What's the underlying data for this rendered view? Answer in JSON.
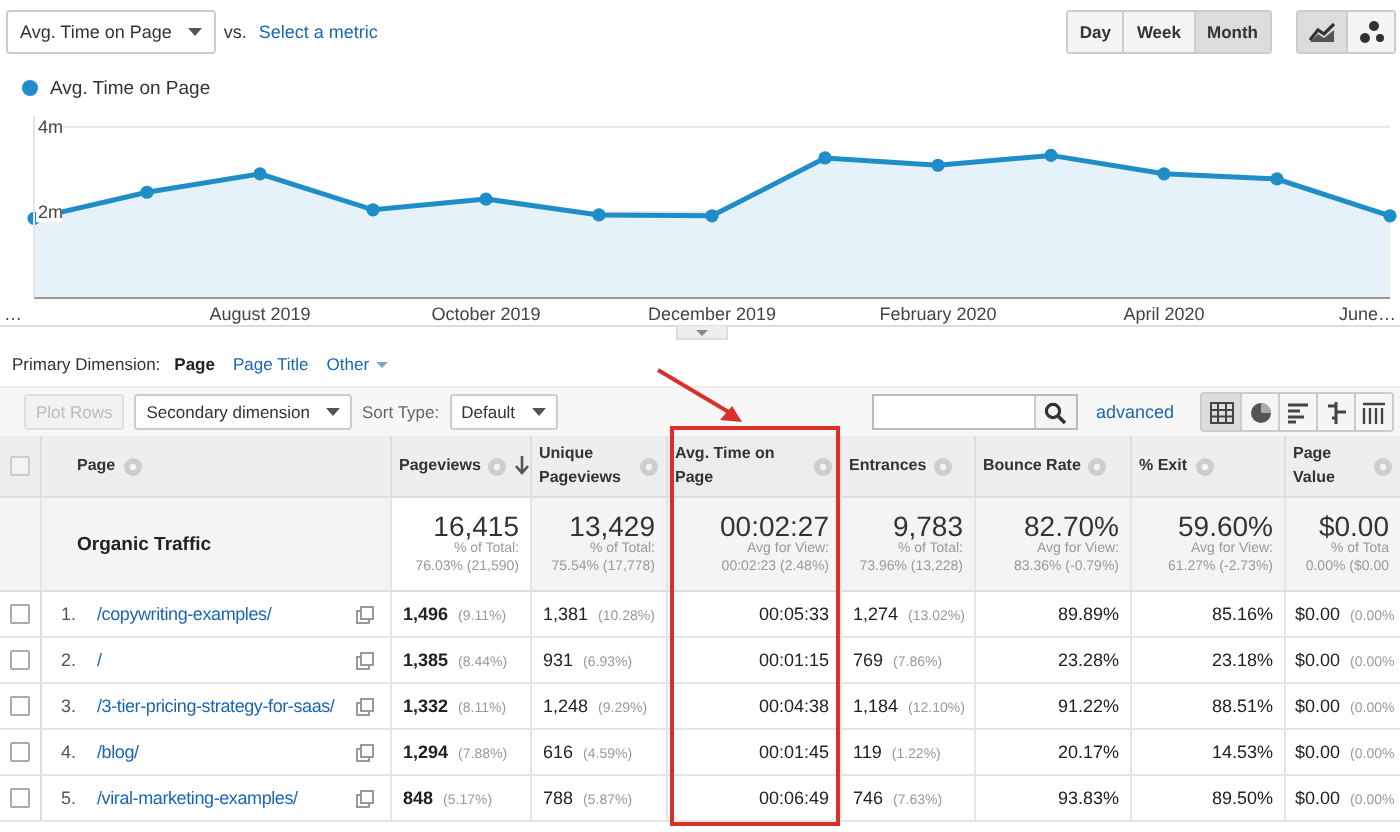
{
  "metric_selector": {
    "value": "Avg. Time on Page"
  },
  "vs_label": "vs.",
  "select_metric_link": "Select a metric",
  "period_buttons": [
    {
      "label": "Day",
      "selected": false
    },
    {
      "label": "Week",
      "selected": false
    },
    {
      "label": "Month",
      "selected": true
    }
  ],
  "chart_type_buttons": [
    {
      "kind": "line",
      "selected": true
    },
    {
      "kind": "motion",
      "selected": false
    }
  ],
  "chart": {
    "chart_data": {
      "type": "area",
      "categories": [
        "…",
        null,
        "August 2019",
        null,
        "October 2019",
        null,
        "December 2019",
        null,
        "February 2020",
        null,
        "April 2020",
        null,
        "June…"
      ],
      "ylim": [
        0,
        4.25
      ],
      "yticks": [
        {
          "value": 2,
          "label": "2m"
        },
        {
          "value": 4,
          "label": "4m"
        }
      ],
      "series": [
        {
          "name": "Avg. Time on Page",
          "color": "#1f8dc8",
          "values": [
            1.86,
            2.47,
            2.9,
            2.06,
            2.31,
            1.94,
            1.92,
            3.27,
            3.1,
            3.33,
            2.9,
            2.78,
            1.92
          ]
        }
      ]
    }
  },
  "primary_dimension": {
    "label": "Primary Dimension:",
    "options": [
      {
        "label": "Page",
        "selected": true
      },
      {
        "label": "Page Title",
        "selected": false
      },
      {
        "label": "Other",
        "selected": false
      }
    ]
  },
  "toolbar": {
    "plot_rows": {
      "label": "Plot Rows",
      "disabled": true
    },
    "secondary_dimension": "Secondary dimension",
    "sort_type_label": "Sort Type:",
    "sort_type": "Default",
    "advanced_link": "advanced",
    "view_buttons": [
      {
        "kind": "table",
        "selected": true
      },
      {
        "kind": "pie",
        "selected": false
      },
      {
        "kind": "performance",
        "selected": false
      },
      {
        "kind": "comparison",
        "selected": false
      },
      {
        "kind": "pivot",
        "selected": false
      }
    ]
  },
  "table": {
    "select_all": {
      "checked": false
    },
    "columns": [
      {
        "label": "Page",
        "sorted": false,
        "highlighted": false
      },
      {
        "label": "Pageviews",
        "sorted": true,
        "highlighted": false
      },
      {
        "label": "Unique Pageviews",
        "sorted": false,
        "highlighted": false
      },
      {
        "label": "Avg. Time on Page",
        "sorted": false,
        "highlighted": true
      },
      {
        "label": "Entrances",
        "sorted": false,
        "highlighted": false
      },
      {
        "label": "Bounce Rate",
        "sorted": false,
        "highlighted": false
      },
      {
        "label": "% Exit",
        "sorted": false,
        "highlighted": false
      },
      {
        "label": "Page Value",
        "sorted": false,
        "highlighted": false
      }
    ],
    "totals": {
      "cells": [
        {
          "value": "Organic Traffic"
        },
        {
          "value": "16,415",
          "note": "% of Total:",
          "detail": "76.03% (21,590)"
        },
        {
          "value": "13,429",
          "note": "% of Total:",
          "detail": "75.54% (17,778)"
        },
        {
          "value": "00:02:27",
          "note": "Avg for View:",
          "detail": "00:02:23 (2.48%)"
        },
        {
          "value": "9,783",
          "note": "% of Total:",
          "detail": "73.96% (13,228)"
        },
        {
          "value": "82.70%",
          "note": "Avg for View:",
          "detail": "83.36% (-0.79%)"
        },
        {
          "value": "59.60%",
          "note": "Avg for View:",
          "detail": "61.27% (-2.73%)"
        },
        {
          "value": "$0.00",
          "note": "% of Tota",
          "detail": "0.00% ($0.00"
        }
      ]
    },
    "rows": [
      {
        "checked": false,
        "cells": [
          {
            "index": "1.",
            "value": "/copywriting-examples/"
          },
          {
            "value": "1,496",
            "pct": "(9.11%)"
          },
          {
            "value": "1,381",
            "pct": "(10.28%)"
          },
          {
            "value": "00:05:33"
          },
          {
            "value": "1,274",
            "pct": "(13.02%)"
          },
          {
            "value": "89.89%"
          },
          {
            "value": "85.16%"
          },
          {
            "value": "$0.00",
            "pct": "(0.00%"
          }
        ]
      },
      {
        "checked": false,
        "cells": [
          {
            "index": "2.",
            "value": "/"
          },
          {
            "value": "1,385",
            "pct": "(8.44%)"
          },
          {
            "value": "931",
            "pct": "(6.93%)"
          },
          {
            "value": "00:01:15"
          },
          {
            "value": "769",
            "pct": "(7.86%)"
          },
          {
            "value": "23.28%"
          },
          {
            "value": "23.18%"
          },
          {
            "value": "$0.00",
            "pct": "(0.00%"
          }
        ]
      },
      {
        "checked": false,
        "cells": [
          {
            "index": "3.",
            "value": "/3-tier-pricing-strategy-for-saas/"
          },
          {
            "value": "1,332",
            "pct": "(8.11%)"
          },
          {
            "value": "1,248",
            "pct": "(9.29%)"
          },
          {
            "value": "00:04:38"
          },
          {
            "value": "1,184",
            "pct": "(12.10%)"
          },
          {
            "value": "91.22%"
          },
          {
            "value": "88.51%"
          },
          {
            "value": "$0.00",
            "pct": "(0.00%"
          }
        ]
      },
      {
        "checked": false,
        "cells": [
          {
            "index": "4.",
            "value": "/blog/"
          },
          {
            "value": "1,294",
            "pct": "(7.88%)"
          },
          {
            "value": "616",
            "pct": "(4.59%)"
          },
          {
            "value": "00:01:45"
          },
          {
            "value": "119",
            "pct": "(1.22%)"
          },
          {
            "value": "20.17%"
          },
          {
            "value": "14.53%"
          },
          {
            "value": "$0.00",
            "pct": "(0.00%"
          }
        ]
      },
      {
        "checked": false,
        "cells": [
          {
            "index": "5.",
            "value": "/viral-marketing-examples/"
          },
          {
            "value": "848",
            "pct": "(5.17%)"
          },
          {
            "value": "788",
            "pct": "(5.87%)"
          },
          {
            "value": "00:06:49"
          },
          {
            "value": "746",
            "pct": "(7.63%)"
          },
          {
            "value": "93.83%"
          },
          {
            "value": "89.50%"
          },
          {
            "value": "$0.00",
            "pct": "(0.00%"
          }
        ]
      }
    ]
  }
}
